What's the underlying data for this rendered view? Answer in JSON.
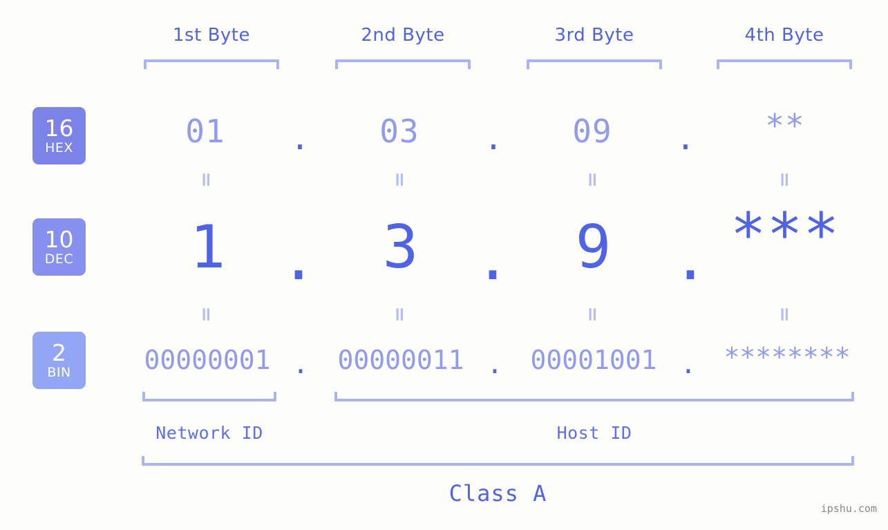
{
  "meta": {
    "watermark": "ipshu.com"
  },
  "byte_headers": [
    {
      "label": "1st Byte"
    },
    {
      "label": "2nd Byte"
    },
    {
      "label": "3rd Byte"
    },
    {
      "label": "4th Byte"
    }
  ],
  "bases": [
    {
      "number": "16",
      "name": "HEX",
      "color": "#7b82e8"
    },
    {
      "number": "10",
      "name": "DEC",
      "color": "#8690ee"
    },
    {
      "number": "2",
      "name": "BIN",
      "color": "#93a6f4"
    }
  ],
  "rows": {
    "hex": {
      "base_number": "16",
      "base_name": "HEX",
      "octets": [
        "01",
        "03",
        "09",
        "**"
      ],
      "separator": "."
    },
    "dec": {
      "base_number": "10",
      "base_name": "DEC",
      "octets": [
        "1",
        "3",
        "9",
        "***"
      ],
      "separator": "."
    },
    "bin": {
      "base_number": "2",
      "base_name": "BIN",
      "octets": [
        "00000001",
        "00000011",
        "00001001",
        "********"
      ],
      "separator": "."
    }
  },
  "equality_marks": {
    "symbol": "=",
    "count_per_row": 4
  },
  "sections": [
    {
      "label": "Network ID"
    },
    {
      "label": "Host ID"
    }
  ],
  "class": {
    "label": "Class A"
  },
  "colors": {
    "background": "#fdfdfa",
    "accent_dark": "#4f63e8",
    "accent_light": "#909bf0",
    "bracket": "#aab4f5"
  }
}
